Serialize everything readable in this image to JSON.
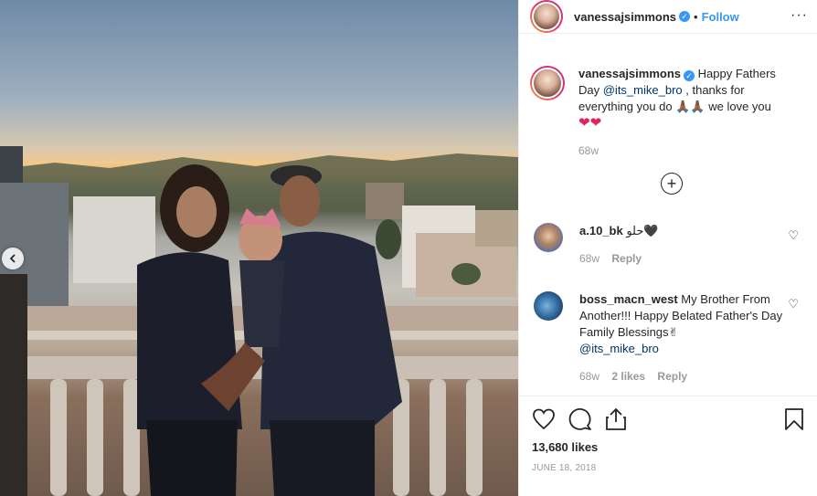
{
  "post": {
    "username": "vanessajsimmons",
    "follow_label": "Follow",
    "separator": "•",
    "more_label": "···"
  },
  "caption": {
    "username": "vanessajsimmons",
    "text_before": "Happy Fathers Day ",
    "mention": "@its_mike_bro",
    "text_after": " , thanks for everything you do 🙏🏾🙏🏾 we love you",
    "hearts": "❤❤",
    "time": "68w"
  },
  "load_more_label": "+",
  "comments": [
    {
      "username": "a.10_bk",
      "text": "حلو🖤",
      "time": "68w",
      "reply": "Reply"
    },
    {
      "username": "boss_macn_west",
      "text": "My Brother From Another!!! Happy Belated Father's Day Family Blessings✌",
      "mention": "@its_mike_bro",
      "time": "68w",
      "likes": "2 likes",
      "reply": "Reply"
    }
  ],
  "likes_label": "13,680 likes",
  "date_label": "JUNE 18, 2018",
  "icons": {
    "heart": "heart-icon",
    "comment": "comment-icon",
    "share": "share-icon",
    "bookmark": "bookmark-icon"
  }
}
